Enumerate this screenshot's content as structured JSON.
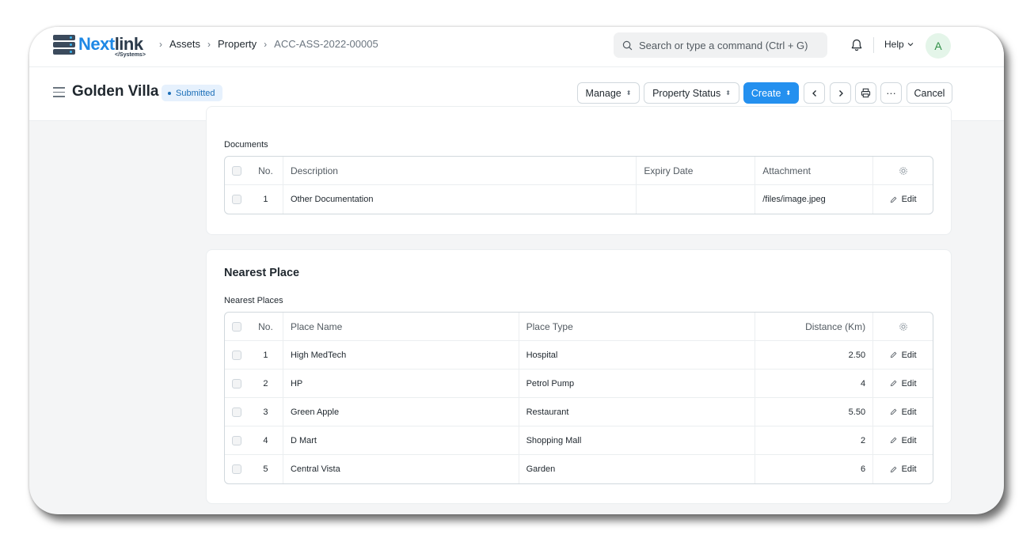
{
  "brand": {
    "name_part1": "Next",
    "name_part2": "link",
    "tagline": "</Systems>"
  },
  "breadcrumbs": [
    "Assets",
    "Property",
    "ACC-ASS-2022-00005"
  ],
  "search": {
    "placeholder": "Search or type a command (Ctrl + G)"
  },
  "nav": {
    "help_label": "Help",
    "avatar_initial": "A"
  },
  "page": {
    "title": "Golden Villa",
    "status": "Submitted",
    "buttons": {
      "manage": "Manage",
      "property_status": "Property Status",
      "create": "Create",
      "more": "···",
      "cancel": "Cancel"
    }
  },
  "documents": {
    "label": "Documents",
    "columns": {
      "no": "No.",
      "description": "Description",
      "expiry_date": "Expiry Date",
      "attachment": "Attachment"
    },
    "rows": [
      {
        "no": "1",
        "description": "Other Documentation",
        "expiry_date": "",
        "attachment": "/files/image.jpeg",
        "edit": "Edit"
      }
    ]
  },
  "nearest_place": {
    "title": "Nearest Place",
    "label": "Nearest Places",
    "columns": {
      "no": "No.",
      "place_name": "Place Name",
      "place_type": "Place Type",
      "distance": "Distance (Km)"
    },
    "rows": [
      {
        "no": "1",
        "place_name": "High MedTech",
        "place_type": "Hospital",
        "distance": "2.50",
        "edit": "Edit"
      },
      {
        "no": "2",
        "place_name": "HP",
        "place_type": "Petrol Pump",
        "distance": "4",
        "edit": "Edit"
      },
      {
        "no": "3",
        "place_name": "Green Apple",
        "place_type": "Restaurant",
        "distance": "5.50",
        "edit": "Edit"
      },
      {
        "no": "4",
        "place_name": "D Mart",
        "place_type": "Shopping Mall",
        "distance": "2",
        "edit": "Edit"
      },
      {
        "no": "5",
        "place_name": "Central Vista",
        "place_type": "Garden",
        "distance": "6",
        "edit": "Edit"
      }
    ]
  },
  "colors": {
    "primary": "#2490ef",
    "badge_bg": "#e6f1fd",
    "badge_text": "#1c6fb8",
    "avatar_bg": "#e4f5e9",
    "avatar_text": "#2f8f46"
  },
  "icons": [
    "search-icon",
    "bell-icon",
    "chevron-down-icon",
    "hamburger-icon",
    "chevron-left-icon",
    "chevron-right-icon",
    "print-icon",
    "gear-icon",
    "pencil-icon",
    "server-icon"
  ]
}
